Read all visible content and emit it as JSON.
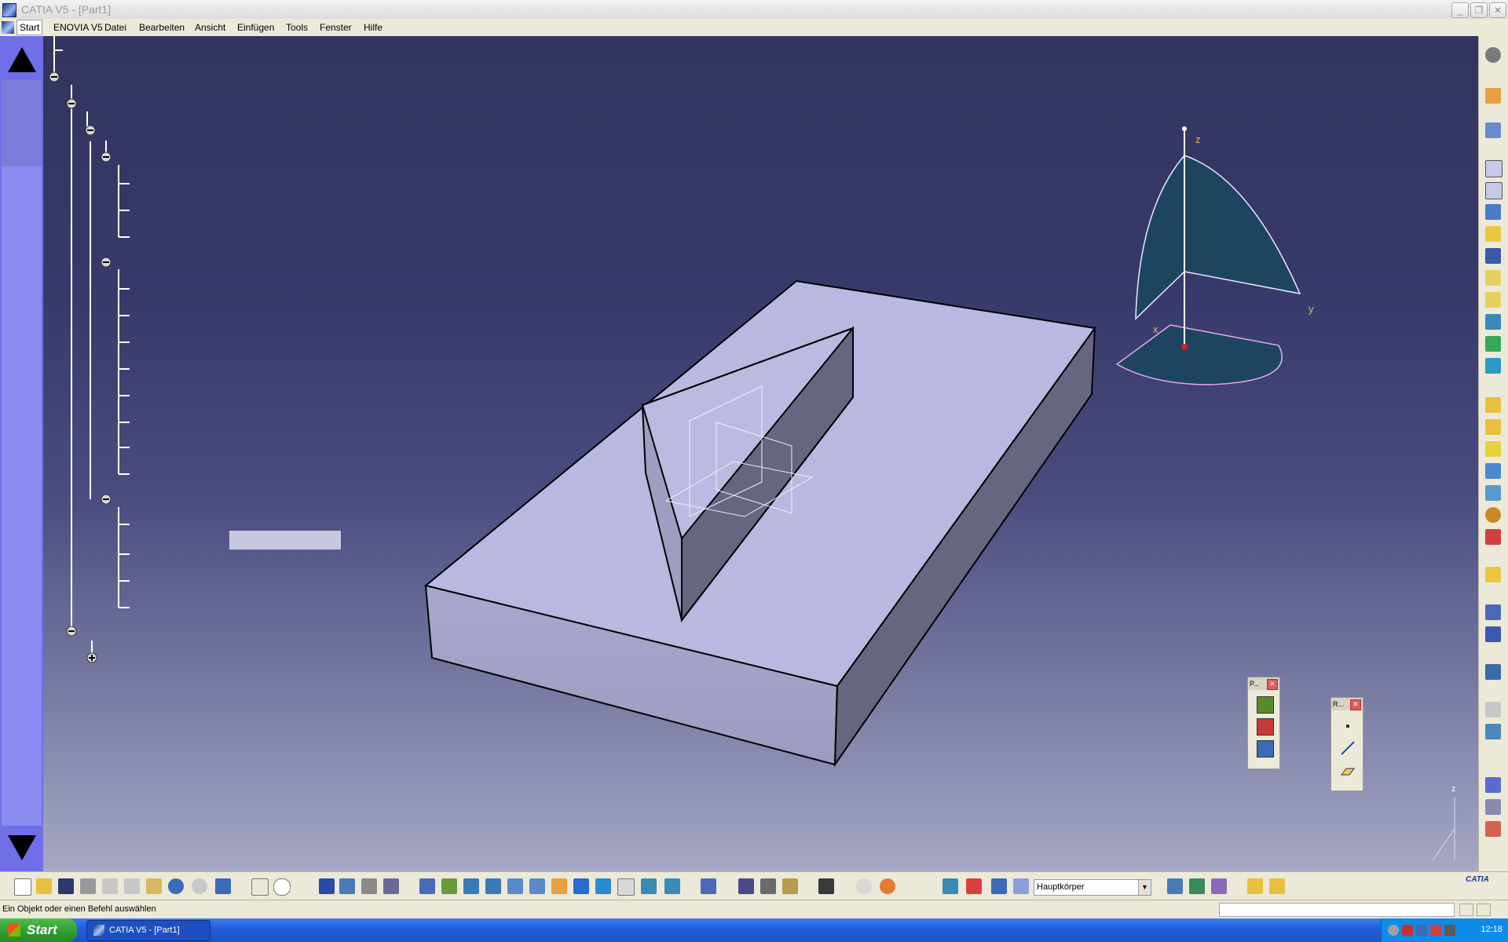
{
  "window": {
    "title": "CATIA V5 - [Part1]"
  },
  "menu": {
    "items": [
      {
        "label": "Start"
      },
      {
        "label": "ENOVIA V5"
      },
      {
        "label": "Datei"
      },
      {
        "label": "Bearbeiten"
      },
      {
        "label": "Ansicht"
      },
      {
        "label": "Einfügen"
      },
      {
        "label": "Tools"
      },
      {
        "label": "Fenster"
      },
      {
        "label": "Hilfe"
      }
    ]
  },
  "compass": {
    "z_label": "z",
    "y_label": "y",
    "x_label": "x"
  },
  "axis_corner": {
    "z_label": "z"
  },
  "floating_toolbars": [
    {
      "caption": "P...",
      "tools": [
        "insert-body-icon",
        "boolean-icon",
        "assemble-icon"
      ]
    },
    {
      "caption": "R...",
      "tools": [
        "point-icon",
        "line-icon",
        "plane-icon"
      ]
    }
  ],
  "bottom_toolbar": {
    "body_select": "Hauptkörper"
  },
  "status": {
    "message": "Ein Objekt oder einen Befehl auswählen"
  },
  "taskbar": {
    "start_label": "Start",
    "task_label": "CATIA V5 - [Part1]",
    "clock": "12:18"
  },
  "brand": {
    "logo_text": "CATIA"
  },
  "colors": {
    "viewport_top": "#33345f",
    "part_face": "#b8b8e0",
    "compass_plane": "#1e4560",
    "left_strip": "#6f6fe8"
  }
}
